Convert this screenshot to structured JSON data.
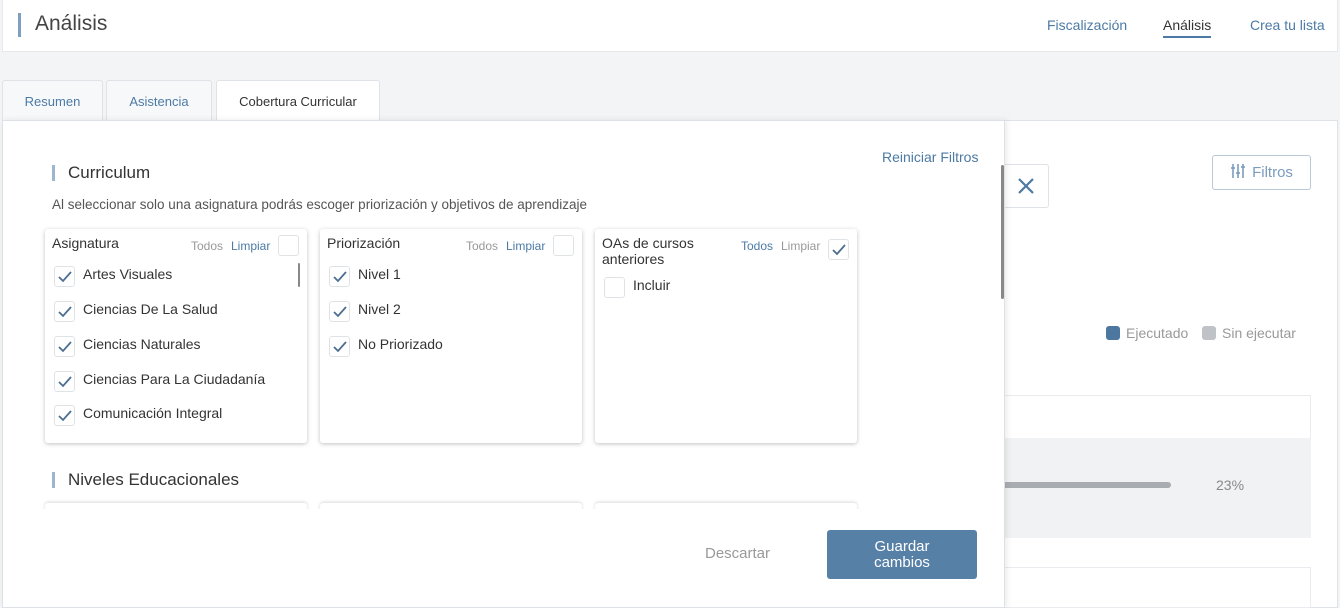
{
  "header": {
    "title": "Análisis",
    "nav": [
      "Fiscalización",
      "Análisis",
      "Crea tu lista"
    ]
  },
  "tabs": [
    "Resumen",
    "Asistencia",
    "Cobertura Curricular"
  ],
  "background": {
    "filtros_label": "Filtros",
    "legend": [
      {
        "label": "Ejecutado",
        "color": "#4e77a0"
      },
      {
        "label": "Sin ejecutar",
        "color": "#bfc3c7"
      }
    ],
    "progress_value": 23,
    "progress_pct": "23%"
  },
  "filters": {
    "reset_label": "Reiniciar Filtros",
    "curriculum_title": "Curriculum",
    "help_text": "Al seleccionar solo una asignatura podrás escoger priorización y objetivos de aprendizaje",
    "niveles_title": "Niveles Educacionales",
    "asignatura": {
      "title": "Asignatura",
      "todos": "Todos",
      "limpiar": "Limpiar",
      "items": [
        "Artes Visuales",
        "Ciencias De La Salud",
        "Ciencias Naturales",
        "Ciencias Para La Ciudadanía",
        "Comunicación Integral"
      ]
    },
    "priorizacion": {
      "title": "Priorización",
      "todos": "Todos",
      "limpiar": "Limpiar",
      "items": [
        "Nivel 1",
        "Nivel 2",
        "No Priorizado"
      ]
    },
    "oas": {
      "title": "OAs de cursos anteriores",
      "todos": "Todos",
      "limpiar": "Limpiar",
      "items": [
        "Incluir"
      ]
    },
    "discard_label": "Descartar",
    "save_label": "Guardar cambios"
  }
}
